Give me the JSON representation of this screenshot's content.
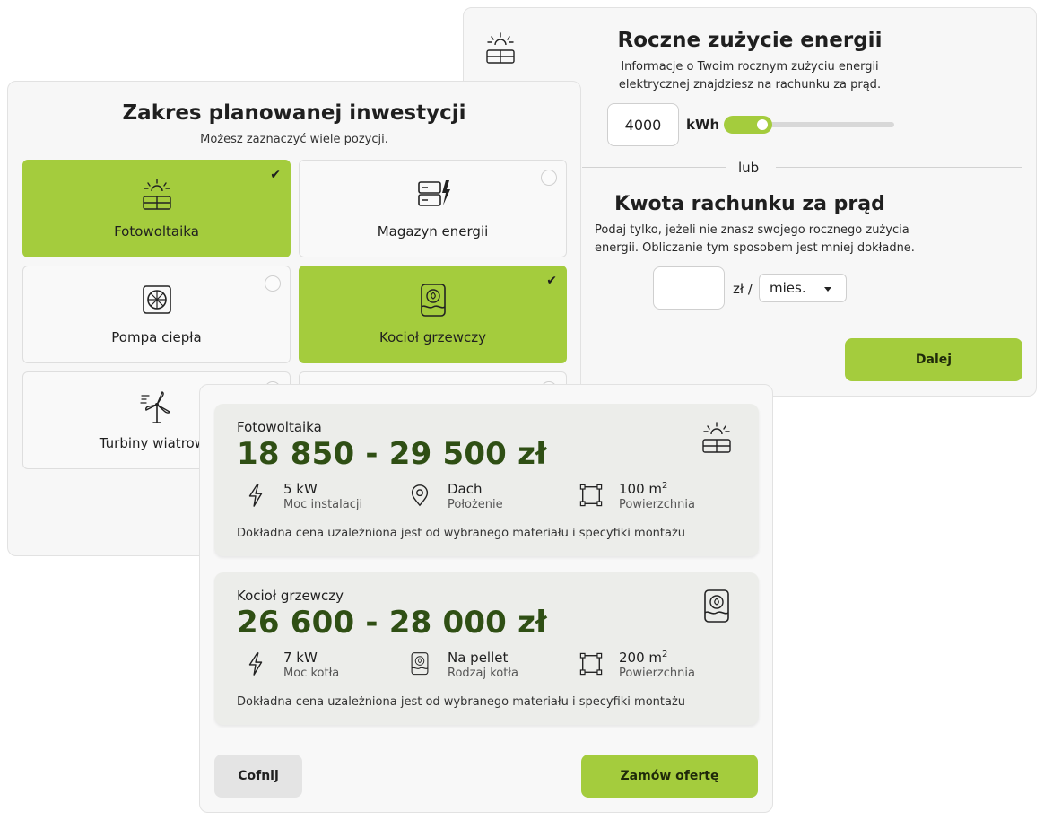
{
  "usage_panel": {
    "title": "Roczne zużycie energii",
    "desc_line1": "Informacje o Twoim rocznym zużyciu energii",
    "desc_line2": "elektrycznej znajdziesz na rachunku za prąd.",
    "kwh_value": "4000",
    "kwh_unit": "kWh",
    "or_label": "lub",
    "bill_title": "Kwota rachunku za prąd",
    "bill_desc_line1": "Podaj tylko, jeżeli nie znasz swojego rocznego zużycia",
    "bill_desc_line2": "energii. Obliczanie tym sposobem jest mniej dokładne.",
    "bill_value": "",
    "currency_sep": "zł /",
    "period_selected": "mies.",
    "next_label": "Dalej",
    "icon": "solar-panel-icon"
  },
  "scope_panel": {
    "title": "Zakres planowanej inwestycji",
    "subtitle": "Możesz zaznaczyć wiele pozycji.",
    "options": [
      {
        "label": "Fotowoltaika",
        "selected": true,
        "icon": "solar-panel-icon"
      },
      {
        "label": "Magazyn energii",
        "selected": false,
        "icon": "battery-storage-icon"
      },
      {
        "label": "Pompa ciepła",
        "selected": false,
        "icon": "heat-pump-icon"
      },
      {
        "label": "Kocioł grzewczy",
        "selected": true,
        "icon": "boiler-icon"
      },
      {
        "label": "Turbiny wiatrowe",
        "selected": false,
        "icon": "wind-turbine-icon"
      },
      {
        "label": "",
        "selected": false,
        "icon": ""
      }
    ],
    "check_mark": "✔"
  },
  "summary_panel": {
    "results": [
      {
        "name": "Fotowoltaika",
        "price": "18 850 - 29 500 zł",
        "icon": "solar-panel-icon",
        "features": [
          {
            "value": "5 kW",
            "label": "Moc instalacji",
            "icon": "lightning-icon"
          },
          {
            "value": "Dach",
            "label": "Położenie",
            "icon": "location-pin-icon"
          },
          {
            "value": "100 m",
            "sup": "2",
            "label": "Powierzchnia",
            "icon": "area-square-icon"
          }
        ],
        "note": "Dokładna cena uzależniona jest od wybranego materiału i specyfiki montażu"
      },
      {
        "name": "Kocioł grzewczy",
        "price": "26 600 - 28 000 zł",
        "icon": "boiler-icon",
        "features": [
          {
            "value": "7 kW",
            "label": "Moc kotła",
            "icon": "lightning-icon"
          },
          {
            "value": "Na pellet",
            "label": "Rodzaj kotła",
            "icon": "boiler-icon"
          },
          {
            "value": "200 m",
            "sup": "2",
            "label": "Powierzchnia",
            "icon": "area-square-icon"
          }
        ],
        "note": "Dokładna cena uzależniona jest od wybranego materiału i specyfiki montażu"
      }
    ],
    "back_label": "Cofnij",
    "order_label": "Zamów ofertę"
  },
  "colors": {
    "accent": "#a4cc3d",
    "price_text": "#2f4f14",
    "result_bg": "#ecedea"
  }
}
